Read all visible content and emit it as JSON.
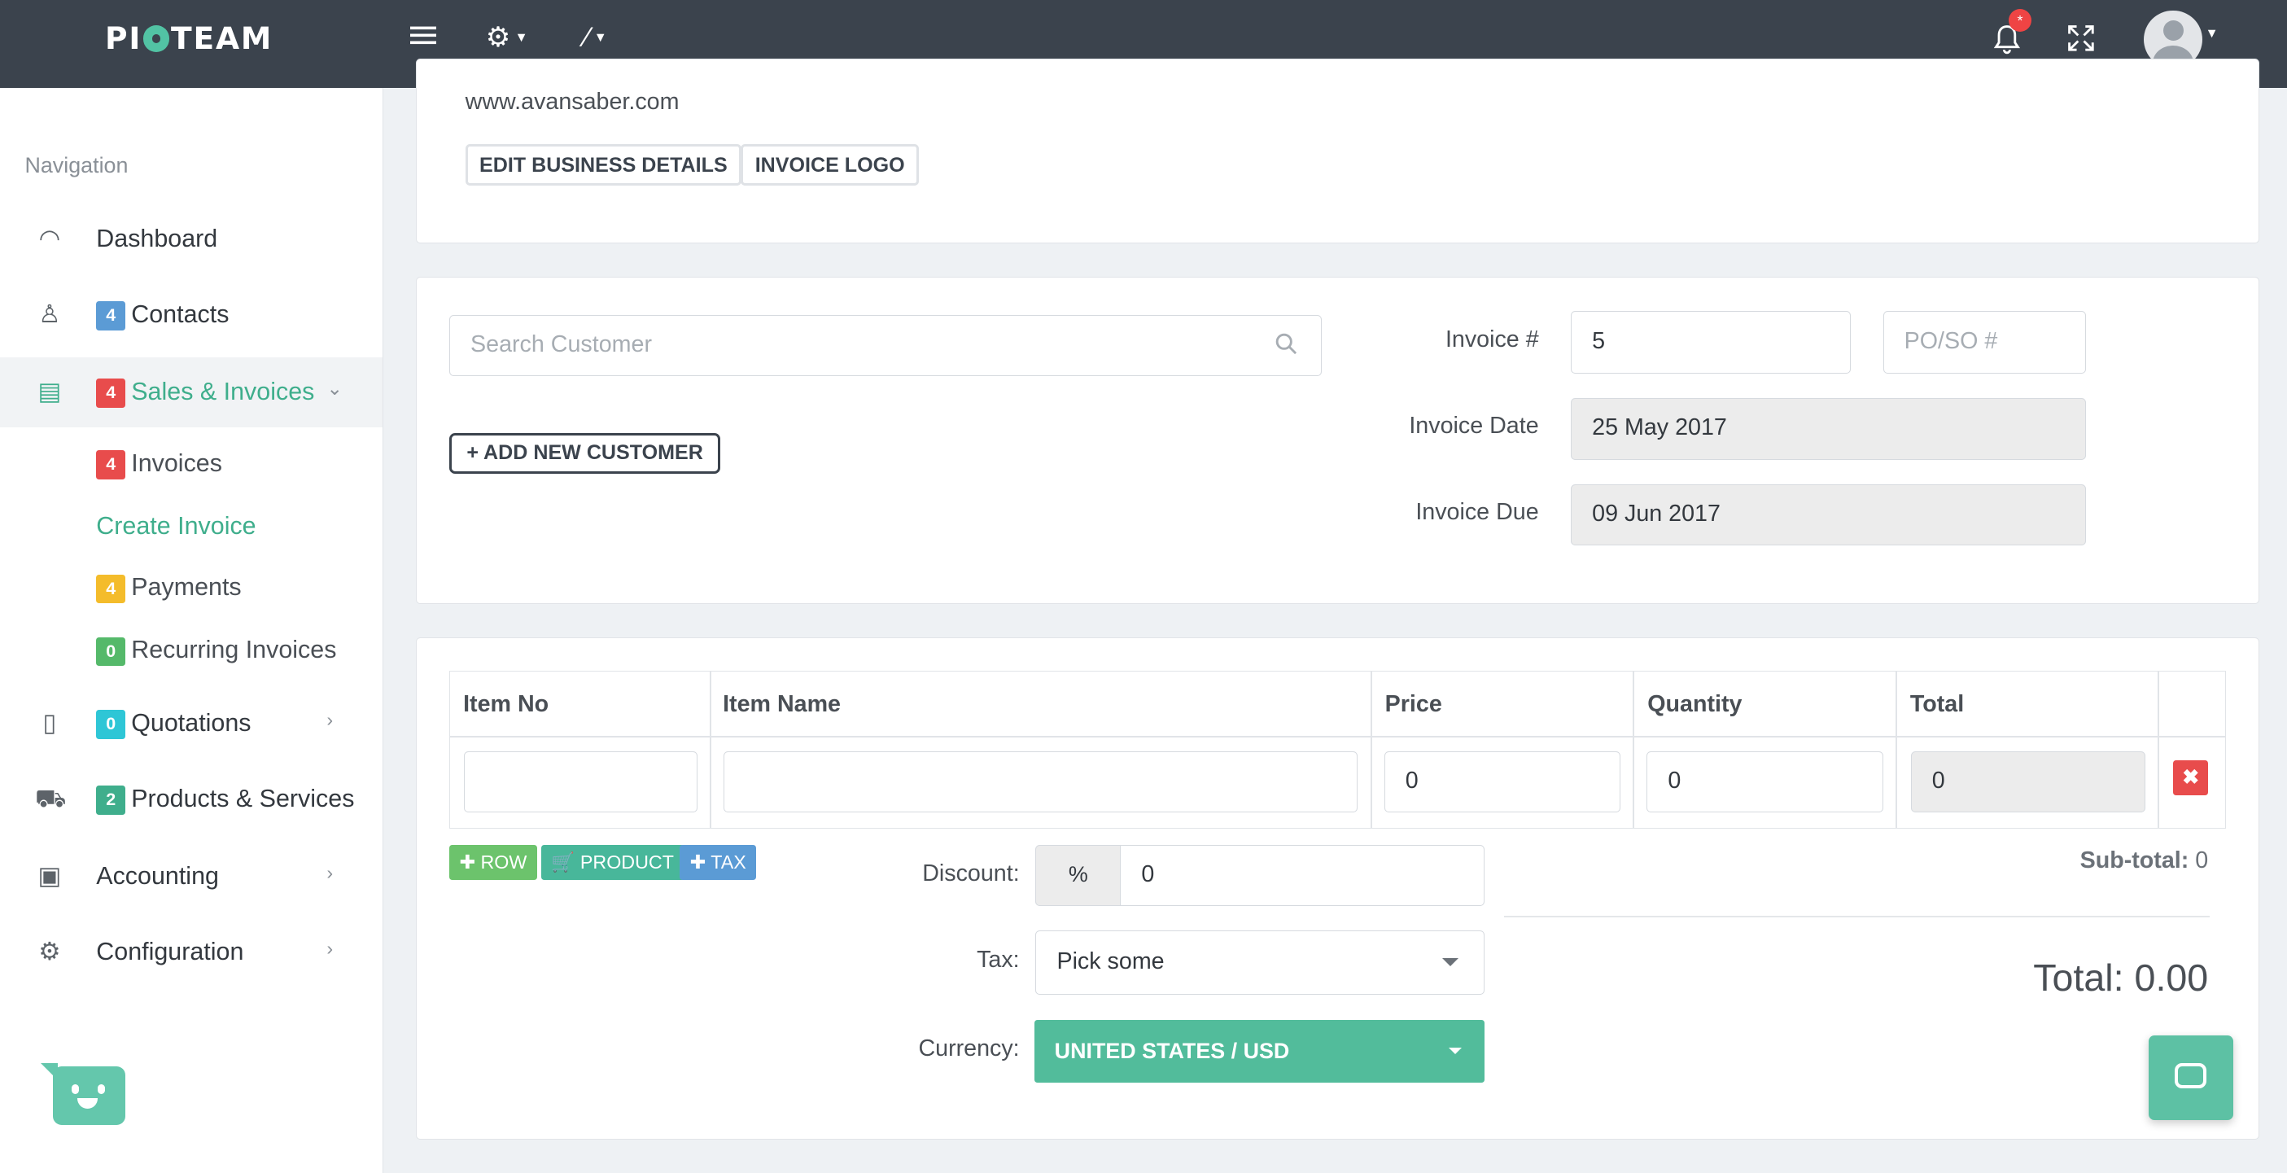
{
  "brand": {
    "logo_left": "PI",
    "logo_right": "TEAM"
  },
  "topbar": {
    "notification_count": "*"
  },
  "sidebar": {
    "title": "Navigation",
    "items": [
      {
        "label": "Dashboard",
        "badge": ""
      },
      {
        "label": "Contacts",
        "badge": "4"
      },
      {
        "label": "Sales & Invoices",
        "badge": "4"
      },
      {
        "label": "Quotations",
        "badge": "0"
      },
      {
        "label": "Products & Services",
        "badge": "2"
      },
      {
        "label": "Accounting",
        "badge": ""
      },
      {
        "label": "Configuration",
        "badge": ""
      }
    ],
    "sub_items": [
      {
        "label": "Invoices",
        "badge": "4"
      },
      {
        "label": "Create Invoice",
        "badge": ""
      },
      {
        "label": "Payments",
        "badge": "4"
      },
      {
        "label": "Recurring Invoices",
        "badge": "0"
      }
    ]
  },
  "business": {
    "website": "www.avansaber.com",
    "edit_button": "EDIT BUSINESS DETAILS",
    "logo_button": "INVOICE LOGO"
  },
  "customer": {
    "search_placeholder": "Search Customer",
    "add_button": "ADD NEW CUSTOMER"
  },
  "invoice": {
    "number_label": "Invoice #",
    "number_value": "5",
    "po_placeholder": "PO/SO #",
    "date_label": "Invoice Date",
    "date_value": "25 May 2017",
    "due_label": "Invoice Due",
    "due_value": "09 Jun 2017"
  },
  "items_table": {
    "headers": [
      "Item No",
      "Item Name",
      "Price",
      "Quantity",
      "Total"
    ],
    "row": {
      "item_no": "",
      "item_name": "",
      "price": "0",
      "quantity": "0",
      "total": "0"
    }
  },
  "actions": {
    "row": "ROW",
    "product": "PRODUCT",
    "tax": "TAX"
  },
  "discount": {
    "label": "Discount:",
    "addon": "%",
    "value": "0"
  },
  "tax": {
    "label": "Tax:",
    "value": "Pick some"
  },
  "currency": {
    "label": "Currency:",
    "value": "UNITED STATES / USD"
  },
  "summary": {
    "subtotal_label": "Sub-total:",
    "subtotal_value": "0",
    "total_text": "Total: 0.00"
  },
  "colors": {
    "topbar": "#3b434d",
    "accent": "#3fae8c",
    "danger": "#e84c4c"
  }
}
